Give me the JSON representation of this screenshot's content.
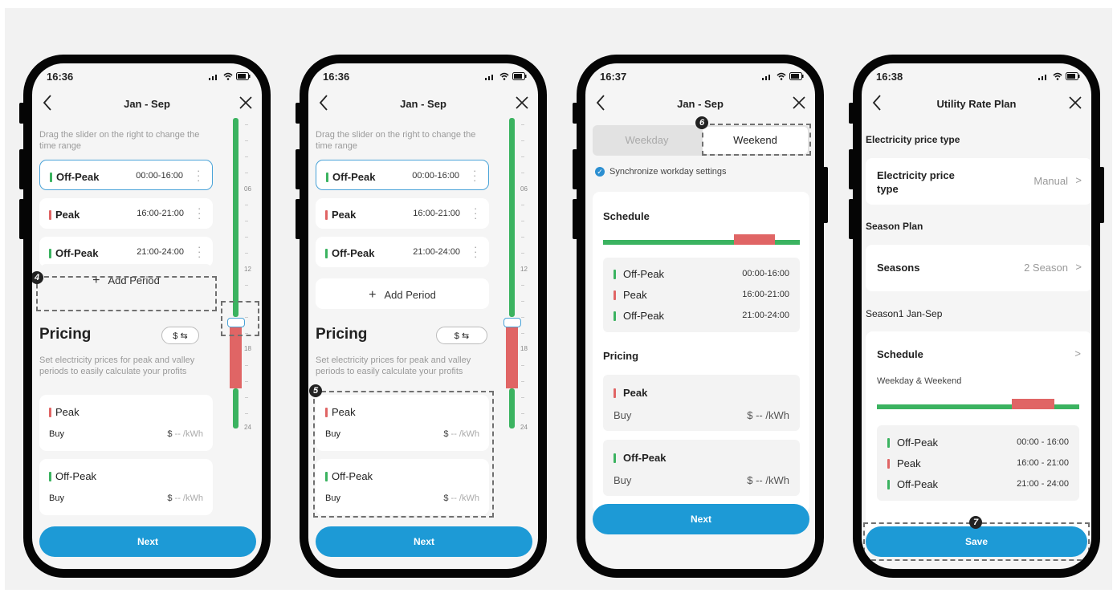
{
  "phone1": {
    "status_time": "16:36",
    "title": "Jan - Sep",
    "hint": "Drag the slider on the right to change the time range",
    "periods": [
      {
        "name": "Off-Peak",
        "range": "00:00-16:00",
        "kind": "offpeak"
      },
      {
        "name": "Peak",
        "range": "16:00-21:00",
        "kind": "peak"
      },
      {
        "name": "Off-Peak",
        "range": "21:00-24:00",
        "kind": "offpeak"
      }
    ],
    "add_period": "Add Period",
    "pricing_title": "Pricing",
    "currency_toggle": "$ ⇆",
    "pricing_desc": "Set electricity prices for peak and valley periods to easily calculate your profits",
    "prices": [
      {
        "name": "Peak",
        "buy_label": "Buy",
        "currency": "$",
        "value": "-- /kWh"
      },
      {
        "name": "Off-Peak",
        "buy_label": "Buy",
        "currency": "$",
        "value": "-- /kWh"
      }
    ],
    "slider_ticks": [
      "06",
      "12",
      "18",
      "24"
    ],
    "next": "Next",
    "badge": "4"
  },
  "phone2": {
    "status_time": "16:36",
    "title": "Jan - Sep",
    "hint": "Drag the slider on the right to change the time range",
    "periods": [
      {
        "name": "Off-Peak",
        "range": "00:00-16:00"
      },
      {
        "name": "Peak",
        "range": "16:00-21:00"
      },
      {
        "name": "Off-Peak",
        "range": "21:00-24:00"
      }
    ],
    "add_period": "Add Period",
    "pricing_title": "Pricing",
    "currency_toggle": "$ ⇆",
    "pricing_desc": "Set electricity prices for peak and valley periods to easily calculate your profits",
    "prices": [
      {
        "name": "Peak",
        "buy_label": "Buy",
        "currency": "$",
        "value": "-- /kWh"
      },
      {
        "name": "Off-Peak",
        "buy_label": "Buy",
        "currency": "$",
        "value": "-- /kWh"
      }
    ],
    "slider_ticks": [
      "06",
      "12",
      "18",
      "24"
    ],
    "next": "Next",
    "badge": "5"
  },
  "phone3": {
    "status_time": "16:37",
    "title": "Jan - Sep",
    "tab_weekday": "Weekday",
    "tab_weekend": "Weekend",
    "sync_label": "Synchronize workday settings",
    "schedule_title": "Schedule",
    "schedule_rows": [
      {
        "name": "Off-Peak",
        "range": "00:00-16:00"
      },
      {
        "name": "Peak",
        "range": "16:00-21:00"
      },
      {
        "name": "Off-Peak",
        "range": "21:00-24:00"
      }
    ],
    "pricing_title": "Pricing",
    "prices": [
      {
        "name": "Peak",
        "buy_label": "Buy",
        "value": "$ -- /kWh"
      },
      {
        "name": "Off-Peak",
        "buy_label": "Buy",
        "value": "$ -- /kWh"
      }
    ],
    "next": "Next",
    "badge": "6"
  },
  "phone4": {
    "status_time": "16:38",
    "title": "Utility Rate Plan",
    "price_type_section": "Electricity price type",
    "price_type_label": "Electricity price type",
    "price_type_value": "Manual",
    "season_plan_section": "Season Plan",
    "seasons_label": "Seasons",
    "seasons_value": "2 Season",
    "season1_section": "Season1 Jan-Sep",
    "schedule_label": "Schedule",
    "schedule_sub": "Weekday & Weekend",
    "schedule_rows": [
      {
        "name": "Off-Peak",
        "range": "00:00 - 16:00"
      },
      {
        "name": "Peak",
        "range": "16:00 - 21:00"
      },
      {
        "name": "Off-Peak",
        "range": "21:00 - 24:00"
      }
    ],
    "save": "Save",
    "badge": "7"
  },
  "colors": {
    "accent": "#1d9ad6",
    "offpeak": "#3bb360",
    "peak": "#e06565"
  }
}
